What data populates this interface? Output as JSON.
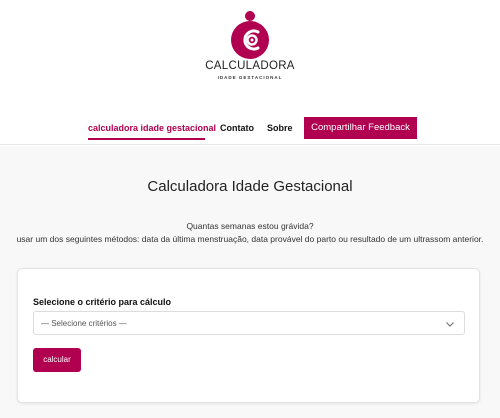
{
  "brand": {
    "name": "CALCULADORA",
    "tagline": "IDADE GESTACIONAL",
    "logo_icon": "mother-baby-logo-icon",
    "color": "#b0004f"
  },
  "nav": {
    "items": [
      {
        "label": "calculadora idade gestacional",
        "active": true
      },
      {
        "label": "Contato",
        "active": false
      },
      {
        "label": "Sobre",
        "active": false
      }
    ],
    "cta_label": "Compartilhar Feedback"
  },
  "main": {
    "title": "Calculadora Idade Gestacional",
    "question": "Quantas semanas estou grávida?",
    "description": "usar um dos seguintes métodos: data da última menstruação, data provável do parto ou resultado de um ultrassom anterior."
  },
  "form": {
    "criteria_label": "Selecione o critério para cálculo",
    "criteria_selected": "— Selecione critérios —",
    "chevron_icon": "chevron-down-icon",
    "submit_label": "calcular"
  }
}
